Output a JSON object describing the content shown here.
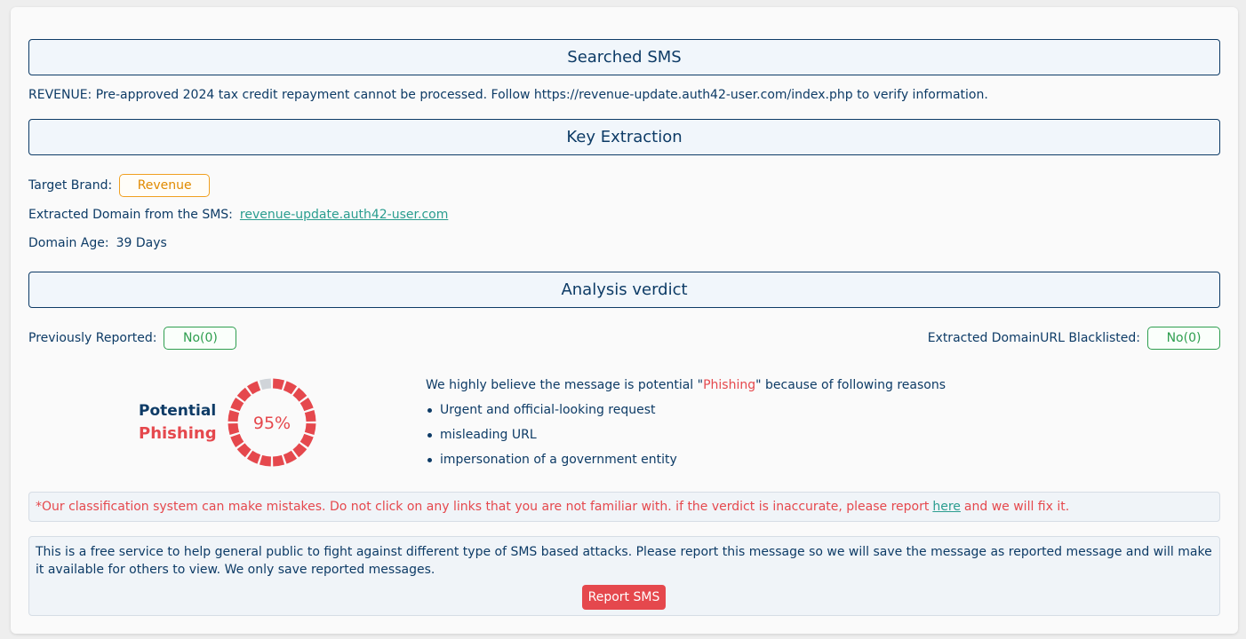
{
  "sections": {
    "searched_sms": "Searched SMS",
    "key_extraction": "Key Extraction",
    "analysis_verdict": "Analysis verdict"
  },
  "sms": {
    "text": "REVENUE: Pre-approved 2024 tax credit repayment cannot be processed. Follow https://revenue-update.auth42-user.com/index.php to verify information."
  },
  "extraction": {
    "target_brand_label": "Target Brand:",
    "target_brand_value": "Revenue",
    "domain_label": "Extracted Domain from the SMS:",
    "domain_value": "revenue-update.auth42-user.com",
    "age_label": "Domain Age:",
    "age_value": "39 Days"
  },
  "verdict": {
    "prev_reported_label": "Previously Reported:",
    "prev_reported_value": "No(0)",
    "blacklisted_label": "Extracted DomainURL Blacklisted:",
    "blacklisted_value": "No(0)",
    "verdict_line1": "Potential",
    "verdict_line2": "Phishing",
    "score_text": "95%",
    "score_fraction": 0.95,
    "reasons_intro_prefix": "We highly believe the message is potential \"",
    "reasons_intro_highlight": "Phishing",
    "reasons_intro_suffix": "\" because of following reasons",
    "reasons": [
      "Urgent and official-looking request",
      "misleading URL",
      "impersonation of a government entity"
    ]
  },
  "disclaimer": {
    "prefix": "*Our classification system can make mistakes. Do not click on any links that you are not familiar with. if the verdict is inaccurate, please report",
    "link": "here",
    "suffix": "and we will fix it."
  },
  "info": {
    "text": "This is a free service to help general public to fight against different type of SMS based attacks. Please report this message so we will save the message as reported message and will make it available for others to view. We only save reported messages.",
    "report_button": "Report SMS"
  },
  "colors": {
    "primary": "#0d3b66",
    "danger": "#e5484d",
    "success": "#2e9e4f",
    "warning": "#e08a00",
    "link": "#2a9d8f",
    "donut_track": "#d0d4d9"
  }
}
